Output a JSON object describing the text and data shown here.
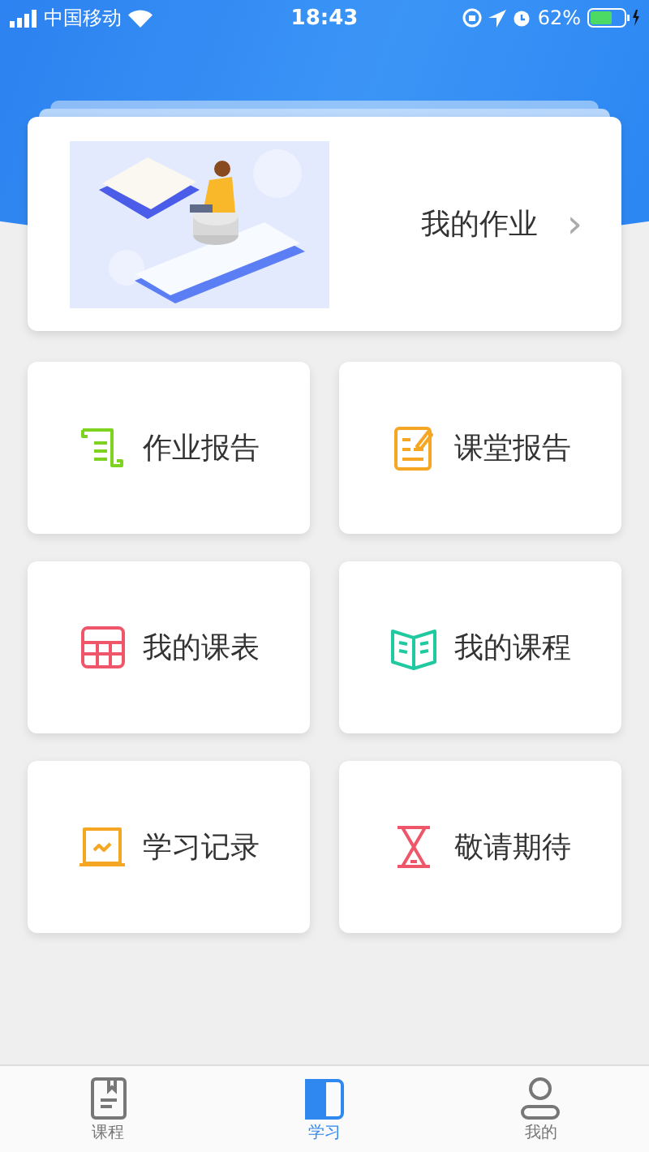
{
  "status_bar": {
    "carrier": "中国移动",
    "time": "18:43",
    "battery": "62%"
  },
  "homework_card": {
    "title": "我的作业",
    "arrow": "›"
  },
  "tiles": [
    {
      "label": "作业报告",
      "kind": "scroll",
      "color": "#7ed321"
    },
    {
      "label": "课堂报告",
      "kind": "notepad",
      "color": "#f5a623"
    },
    {
      "label": "我的课表",
      "kind": "table",
      "color": "#f0566a"
    },
    {
      "label": "我的课程",
      "kind": "book",
      "color": "#20c9a0"
    },
    {
      "label": "学习记录",
      "kind": "chart",
      "color": "#f5a623"
    },
    {
      "label": "敬请期待",
      "kind": "hourglass",
      "color": "#f0566a"
    }
  ],
  "tab_bar": [
    {
      "label": "课程",
      "kind": "course",
      "selected": false
    },
    {
      "label": "学习",
      "kind": "study",
      "selected": true
    },
    {
      "label": "我的",
      "kind": "profile",
      "selected": false
    }
  ]
}
